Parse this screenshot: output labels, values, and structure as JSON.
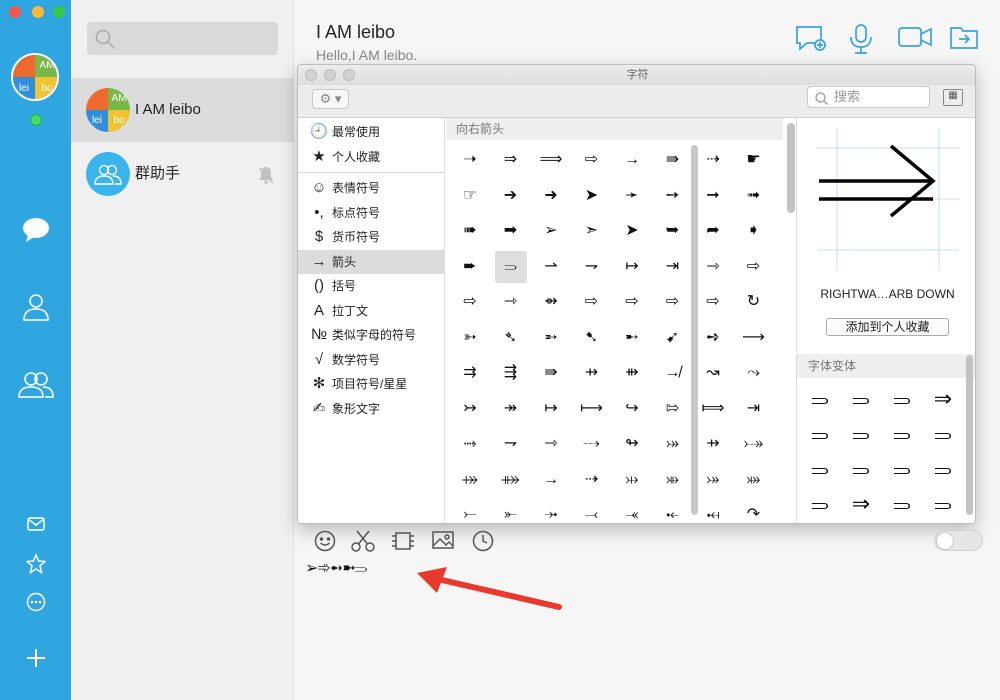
{
  "contacts": [
    {
      "name": "I AM leibo",
      "avatar_cells": [
        "AM",
        "lei",
        "bo"
      ]
    },
    {
      "name": "群助手"
    }
  ],
  "chat": {
    "title": "I AM leibo",
    "subtitle": "Hello,I AM leibo."
  },
  "viewer": {
    "title": "字符",
    "search_placeholder": "搜索",
    "categories_top": [
      {
        "glyph": "🕘",
        "label": "最常使用"
      },
      {
        "glyph": "★",
        "label": "个人收藏"
      }
    ],
    "categories": [
      {
        "glyph": "☺",
        "label": "表情符号"
      },
      {
        "glyph": "•,",
        "label": "标点符号"
      },
      {
        "glyph": "$",
        "label": "货币符号"
      },
      {
        "glyph": "→",
        "label": "箭头"
      },
      {
        "glyph": "()",
        "label": "括号"
      },
      {
        "glyph": "A",
        "label": "拉丁文"
      },
      {
        "glyph": "№",
        "label": "类似字母的符号"
      },
      {
        "glyph": "√",
        "label": "数学符号"
      },
      {
        "glyph": "✻",
        "label": "项目符号/星星"
      },
      {
        "glyph": "✍",
        "label": "象形文字"
      }
    ],
    "grid_header": "向右箭头",
    "grid_rows": [
      [
        "➝",
        "⇒",
        "⟹",
        "⇨",
        "→",
        "⇛",
        "⇢",
        "☛"
      ],
      [
        "☞",
        "➔",
        "➜",
        "➤",
        "➛",
        "➙",
        "➞",
        "➟"
      ],
      [
        "➠",
        "➡",
        "➢",
        "➣",
        "➤",
        "➥",
        "➦",
        "➧"
      ],
      [
        "➨",
        "⥰",
        "⇀",
        "⇁",
        "↦",
        "⇥",
        "⇾",
        "⇨"
      ],
      [
        "⇨",
        "⇾",
        "⇴",
        "⇨",
        "⇨",
        "⇨",
        "⇨",
        "↻"
      ],
      [
        "➳",
        "➴",
        "➵",
        "➷",
        "➸",
        "➹",
        "➺",
        "⟶"
      ],
      [
        "⇉",
        "⇶",
        "⇛",
        "⇸",
        "⇻",
        "↛",
        "↝",
        "⤳"
      ],
      [
        "↣",
        "↠",
        "↦",
        "⟼",
        "↪",
        "⇰",
        "⟾",
        "⇥"
      ],
      [
        "⤑",
        "⇁",
        "⇾",
        "⤏",
        "↬",
        "⤖",
        "⇸",
        "⤐"
      ],
      [
        "⤀",
        "⤁",
        "→",
        "⇢",
        "⤔",
        "⤕",
        "⤖",
        "⤗"
      ],
      [
        "⤚",
        "⤜",
        "⤞",
        "⤙",
        "⤛",
        "⤝",
        "⤟",
        "↷"
      ]
    ],
    "detail": {
      "name": "RIGHTWA…ARB DOWN",
      "add_button": "添加到个人收藏"
    },
    "variants_header": "字体变体",
    "variants": [
      "⥰",
      "⥰",
      "⥰",
      "⇒",
      "⥰",
      "⥰",
      "⥰",
      "⥰",
      "⥰",
      "⥰",
      "⥰",
      "⥰",
      "⥰",
      "⇒",
      "⥰",
      "⥰"
    ]
  },
  "composer": {
    "text": "➢➾➻➼⥰"
  }
}
